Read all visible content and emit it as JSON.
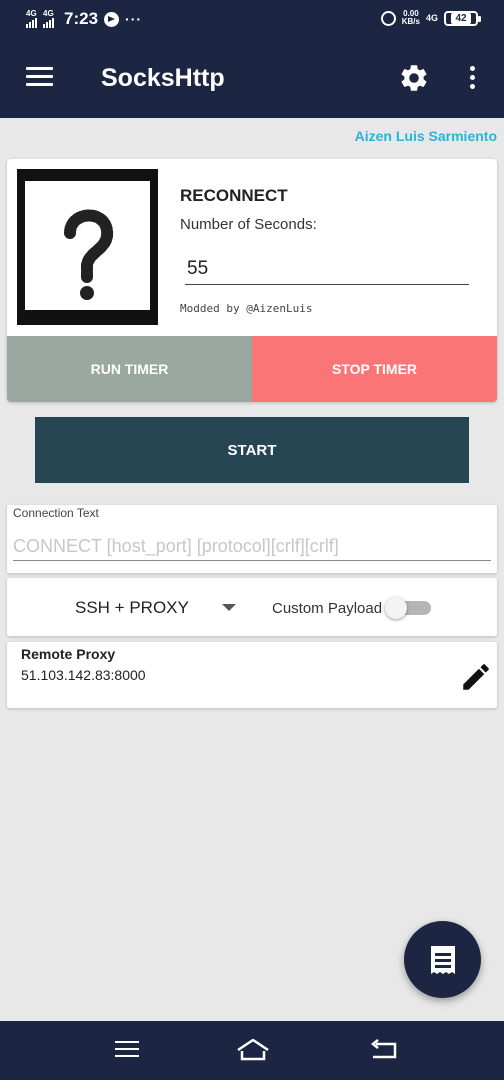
{
  "status_bar": {
    "signal_1": "4G",
    "signal_2": "4G",
    "time": "7:23",
    "more": "···",
    "speed_value": "0.00",
    "speed_unit": "KB/s",
    "network": "4G",
    "battery": "42"
  },
  "toolbar": {
    "title": "SocksHttp",
    "menu_icon": "hamburger-menu-icon",
    "settings_icon": "gear-icon",
    "overflow_icon": "more-vert-icon"
  },
  "author": "Aizen Luis Sarmiento",
  "timer": {
    "heading": "RECONNECT",
    "seconds_label": "Number of Seconds:",
    "seconds_value": "55",
    "credit": "Modded by @AizenLuis",
    "run_label": "RUN TIMER",
    "stop_label": "STOP TIMER",
    "run_color": "#9aa8a1",
    "stop_color": "#fa7676"
  },
  "start_label": "START",
  "connection": {
    "label": "Connection Text",
    "placeholder": "CONNECT [host_port] [protocol][crlf][crlf]",
    "value": ""
  },
  "mode": {
    "selected": "SSH + PROXY",
    "custom_payload_label": "Custom Payload",
    "custom_payload_on": false
  },
  "proxy": {
    "title": "Remote Proxy",
    "value": "51.103.142.83:8000",
    "edit_icon": "pencil-icon"
  },
  "fab_icon": "log-icon",
  "nav": {
    "menu_icon": "menu-icon",
    "home_icon": "home-icon",
    "back_icon": "back-icon"
  },
  "colors": {
    "primary": "#1c2541",
    "accent": "#27b3da",
    "start": "#264653"
  }
}
